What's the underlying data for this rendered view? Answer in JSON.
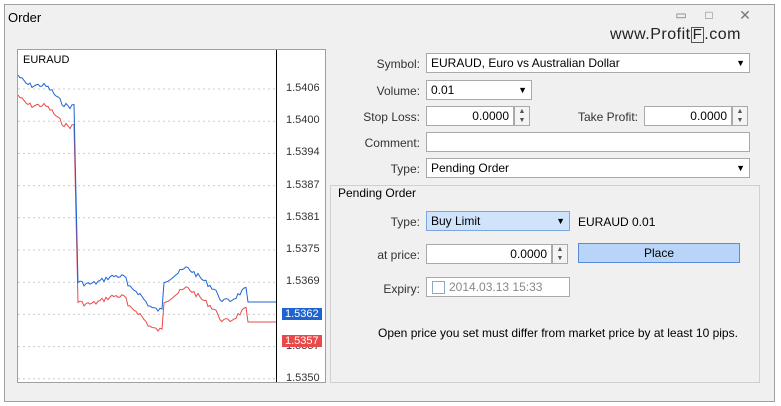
{
  "window": {
    "title": "Order",
    "minimize_icon": "minimize-icon",
    "maximize_icon": "maximize-icon",
    "close_icon": "close-icon"
  },
  "watermark": {
    "prefix": "www.Profit",
    "boxed": "F",
    "suffix": ".com"
  },
  "chart": {
    "symbol": "EURAUD",
    "price_labels": [
      "1.5406",
      "1.5400",
      "1.5394",
      "1.5387",
      "1.5381",
      "1.5375",
      "1.5369",
      "1.5362",
      "1.5357",
      "1.5350"
    ],
    "bid_tag": "1.5362",
    "ask_tag": "1.5357",
    "colors": {
      "bid": "#1e64d0",
      "ask": "#e84a4a"
    }
  },
  "form": {
    "symbol_label": "Symbol:",
    "symbol_value": "EURAUD, Euro vs Australian Dollar",
    "volume_label": "Volume:",
    "volume_value": "0.01",
    "stop_loss_label": "Stop Loss:",
    "stop_loss_value": "0.0000",
    "take_profit_label": "Take Profit:",
    "take_profit_value": "0.0000",
    "comment_label": "Comment:",
    "comment_value": "",
    "type_label": "Type:",
    "type_value": "Pending Order"
  },
  "pending": {
    "group_title": "Pending Order",
    "type_label": "Type:",
    "type_value": "Buy Limit",
    "summary": "EURAUD 0.01",
    "at_price_label": "at price:",
    "at_price_value": "0.0000",
    "place_label": "Place",
    "expiry_label": "Expiry:",
    "expiry_value": "2014.03.13 15:33",
    "note": "Open price you set must differ from market price by at least 10 pips."
  }
}
